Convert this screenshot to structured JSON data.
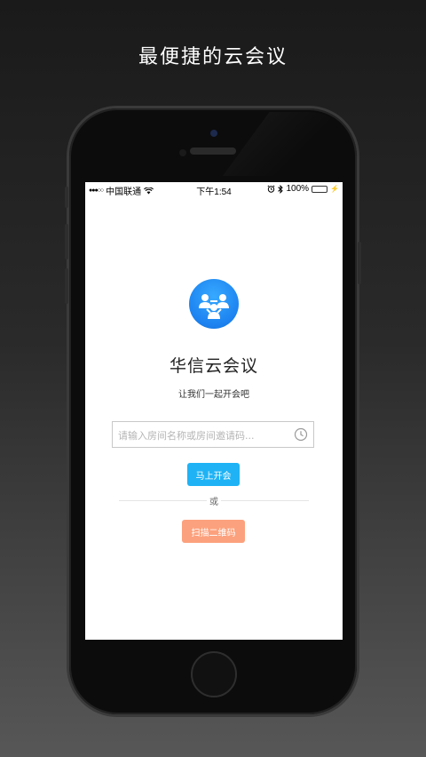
{
  "headline": "最便捷的云会议",
  "status_bar": {
    "signal": "●●●○○",
    "carrier": "中国联通",
    "wifi": "wifi-icon",
    "time": "下午1:54",
    "alarm": "alarm-icon",
    "bluetooth": "bluetooth-icon",
    "battery_percent": "100%",
    "battery_level": 1.0,
    "charging": "⚡"
  },
  "app": {
    "icon": "meeting-people-icon",
    "title": "华信云会议",
    "subtitle": "让我们一起开会吧",
    "room_input": {
      "placeholder": "请输入房间名称或房间邀请码...",
      "value": "",
      "history_icon": "clock-icon"
    },
    "start_button": "马上开会",
    "or_label": "或",
    "scan_button": "扫描二维码"
  },
  "colors": {
    "accent_blue": "#1fb3f5",
    "accent_orange": "#fca17d",
    "icon_blue": "#1c82f0"
  }
}
